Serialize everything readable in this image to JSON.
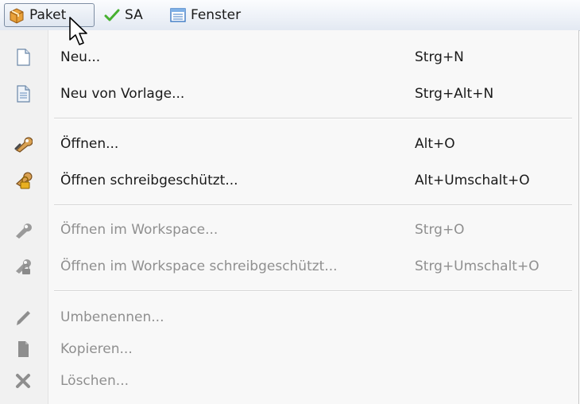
{
  "menubar": {
    "items": [
      {
        "label": "Paket",
        "icon": "package-icon"
      },
      {
        "label": "SA",
        "icon": "checkmark-icon"
      },
      {
        "label": "Fenster",
        "icon": "window-icon"
      }
    ]
  },
  "menu": {
    "items": [
      {
        "label": "Neu...",
        "shortcut": "Strg+N",
        "icon": "new-document-icon",
        "enabled": true
      },
      {
        "label": "Neu von Vorlage...",
        "shortcut": "Strg+Alt+N",
        "icon": "template-document-icon",
        "enabled": true
      },
      {
        "label": "Öffnen...",
        "shortcut": "Alt+O",
        "icon": "open-wrench-icon",
        "enabled": true
      },
      {
        "label": "Öffnen schreibgeschützt...",
        "shortcut": "Alt+Umschalt+O",
        "icon": "open-locked-icon",
        "enabled": true
      },
      {
        "label": "Öffnen im Workspace...",
        "shortcut": "Strg+O",
        "icon": "wrench-icon",
        "enabled": false
      },
      {
        "label": "Öffnen im Workspace schreibgeschützt...",
        "shortcut": "Strg+Umschalt+O",
        "icon": "wrench-locked-icon",
        "enabled": false
      },
      {
        "label": "Umbenennen...",
        "shortcut": "",
        "icon": "pencil-icon",
        "enabled": false
      },
      {
        "label": "Kopieren...",
        "shortcut": "",
        "icon": "copy-icon",
        "enabled": false
      },
      {
        "label": "Löschen...",
        "shortcut": "",
        "icon": "delete-icon",
        "enabled": false
      }
    ]
  },
  "colors": {
    "menubar_bg": "#eef2f8",
    "menu_bg": "#f8f8f8",
    "text": "#1a1a1a",
    "disabled_text": "#8f8f8f",
    "check_green": "#46b030",
    "package_orange": "#e49a2a"
  }
}
